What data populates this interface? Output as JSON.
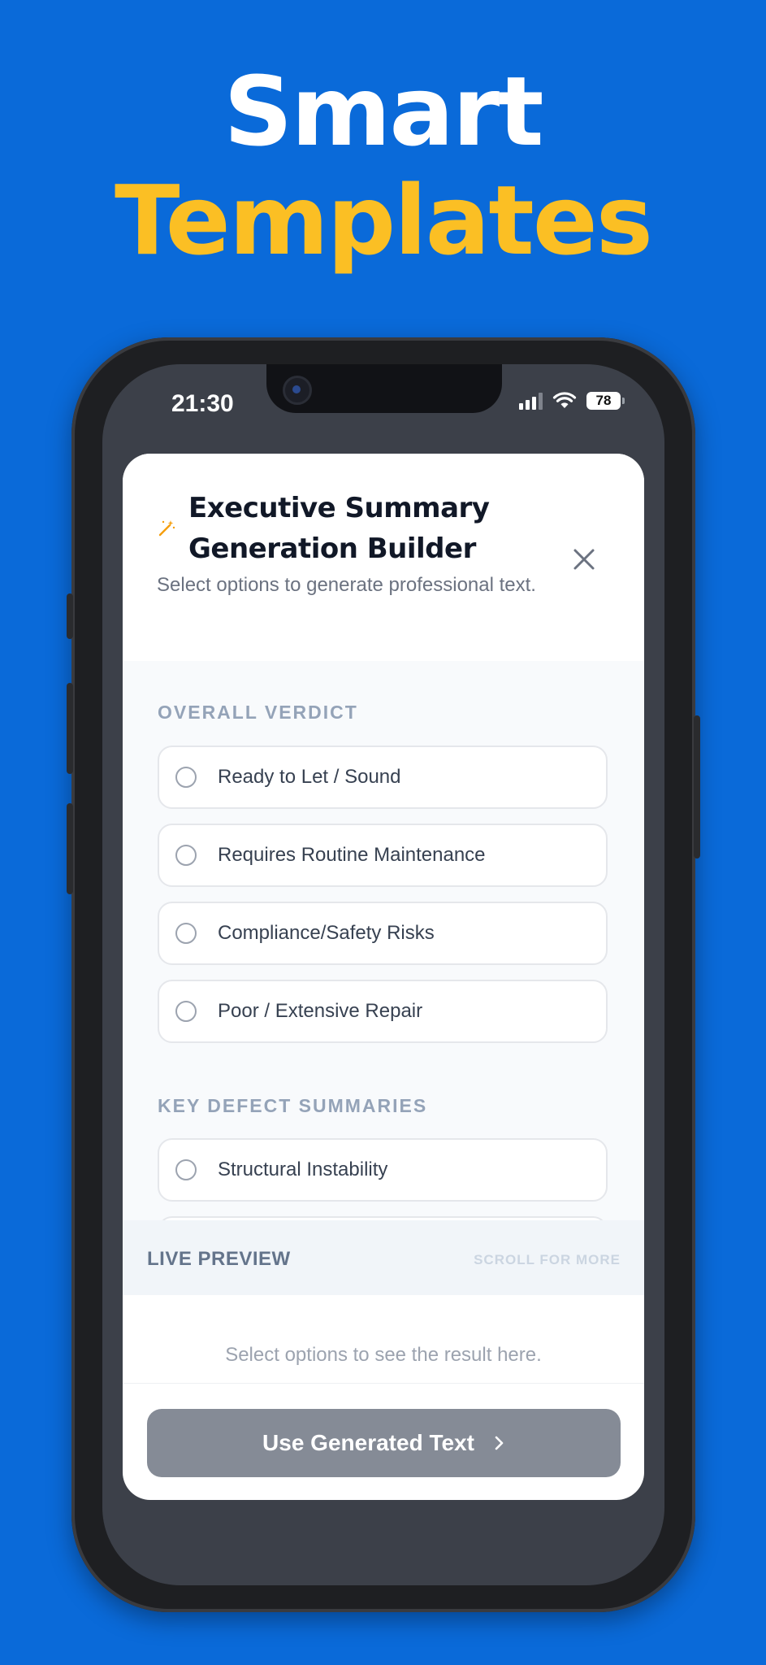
{
  "headline": {
    "line1": "Smart",
    "line2": "Templates"
  },
  "status_bar": {
    "time": "21:30",
    "battery": "78"
  },
  "modal": {
    "title": "Executive Summary Generation Builder",
    "subtitle": "Select options to generate professional text.",
    "sections": [
      {
        "label": "OVERALL VERDICT",
        "options": [
          "Ready to Let / Sound",
          "Requires Routine Maintenance",
          "Compliance/Safety Risks",
          "Poor / Extensive Repair"
        ]
      },
      {
        "label": "KEY DEFECT SUMMARIES",
        "options": [
          "Structural Instability"
        ]
      }
    ],
    "preview": {
      "title": "LIVE PREVIEW",
      "hint": "SCROLL FOR MORE",
      "placeholder": "Select options to see the result here."
    },
    "action_button": "Use Generated Text"
  },
  "colors": {
    "background": "#0a6ad9",
    "headline_accent": "#fbbf24",
    "wand_icon": "#f59e0b",
    "button_disabled": "#858b96"
  }
}
